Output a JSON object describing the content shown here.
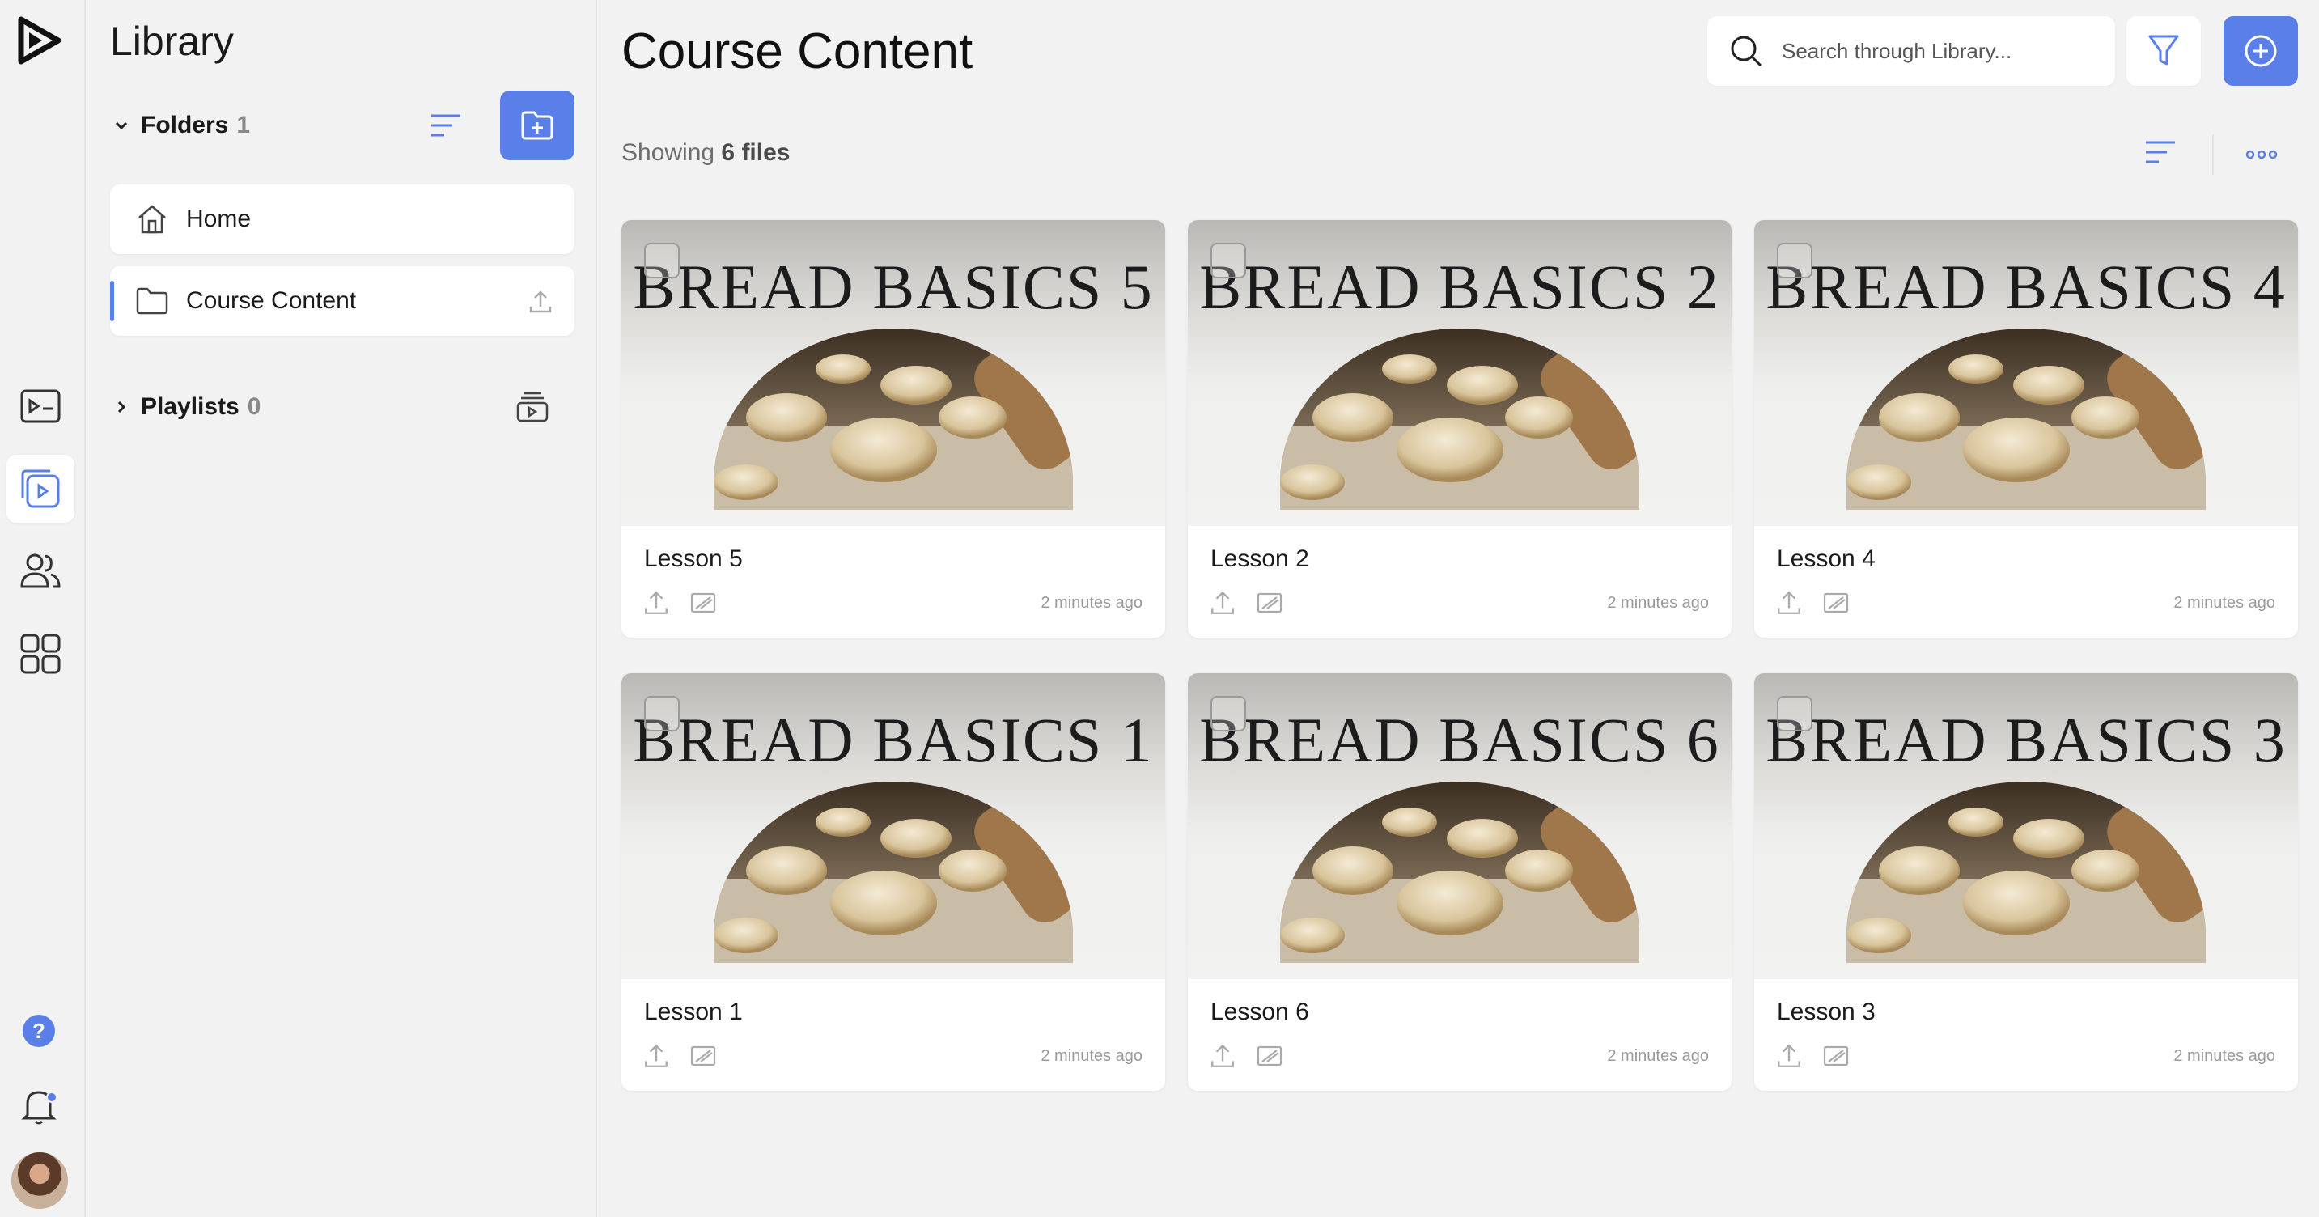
{
  "sidebar": {
    "title": "Library",
    "folders": {
      "label": "Folders",
      "count": "1"
    },
    "playlists": {
      "label": "Playlists",
      "count": "0"
    },
    "items": [
      {
        "label": "Home",
        "icon": "home-icon"
      },
      {
        "label": "Course Content",
        "icon": "folder-icon"
      }
    ]
  },
  "header": {
    "title": "Course Content",
    "search_placeholder": "Search through Library..."
  },
  "summary": {
    "prefix": "Showing",
    "count_text": "6 files"
  },
  "colors": {
    "accent": "#5a7fe8"
  },
  "cards": [
    {
      "thumb_title": "BREAD BASICS 5",
      "name": "Lesson 5",
      "time": "2 minutes ago"
    },
    {
      "thumb_title": "BREAD BASICS 2",
      "name": "Lesson 2",
      "time": "2 minutes ago"
    },
    {
      "thumb_title": "BREAD BASICS 4",
      "name": "Lesson 4",
      "time": "2 minutes ago"
    },
    {
      "thumb_title": "BREAD BASICS 1",
      "name": "Lesson 1",
      "time": "2 minutes ago"
    },
    {
      "thumb_title": "BREAD BASICS 6",
      "name": "Lesson 6",
      "time": "2 minutes ago"
    },
    {
      "thumb_title": "BREAD BASICS 3",
      "name": "Lesson 3",
      "time": "2 minutes ago"
    }
  ]
}
